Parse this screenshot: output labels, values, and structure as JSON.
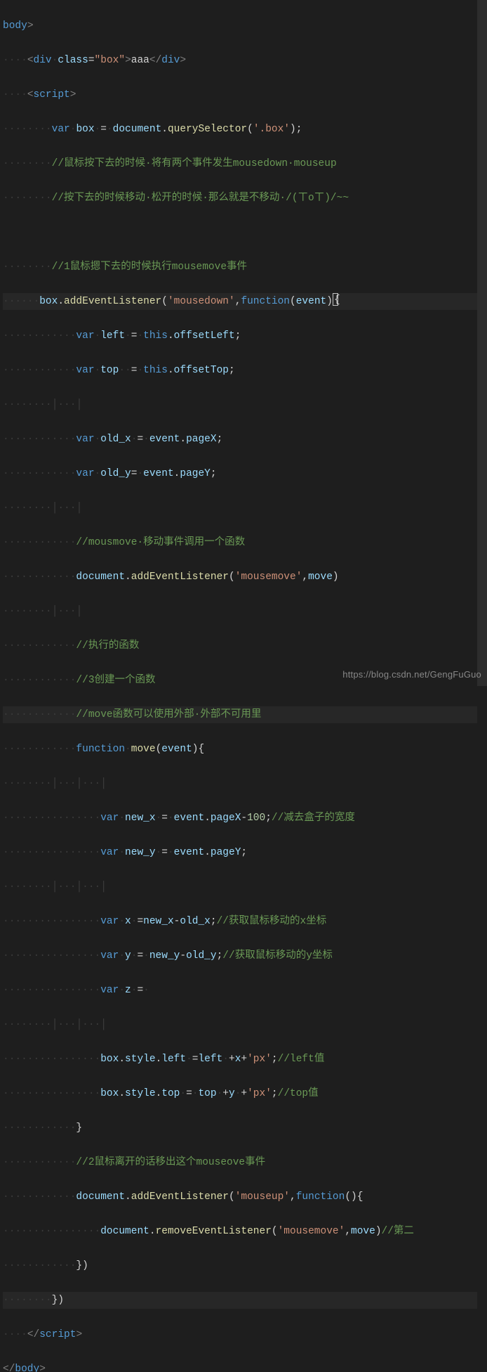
{
  "watermark": "https://blog.csdn.net/GengFuGuo",
  "code": {
    "l1": {
      "tag1": "body",
      "brkt1": ">"
    },
    "l2": {
      "ws": "····",
      "b1": "<",
      "t": "div",
      "sp": "·",
      "a": "class",
      "eq": "=",
      "s": "\"box\"",
      "b2": ">",
      "txt": "aaa",
      "b3": "</",
      "t2": "div",
      "b4": ">"
    },
    "l3": {
      "ws": "····",
      "b1": "<",
      "t": "script",
      "b2": ">"
    },
    "l4": {
      "ws": "········",
      "k1": "var",
      "sp1": "·",
      "v": "box",
      "sp2": "·",
      "eq": "=",
      "sp3": "·",
      "o": "document",
      "d": ".",
      "f": "querySelector",
      "p1": "(",
      "s": "'.box'",
      "p2": ")",
      ";": ";"
    },
    "l5": {
      "ws": "········",
      "c": "//鼠标按下去的时候·将有两个事件发生mousedown·mouseup"
    },
    "l6": {
      "ws": "········",
      "c": "//按下去的时候移动·松开的时候·那么就是不移动·/(ㄒoㄒ)/~~"
    },
    "l7": "",
    "l8": {
      "ws": "········",
      "c": "//1鼠标摁下去的时候执行mousemove事件"
    },
    "l9": {
      "ws": "······",
      "o1": "box",
      "d1": ".",
      "f": "addEventListener",
      "p1": "(",
      "s": "'mousedown'",
      "c1": ",",
      "k": "function",
      "p2": "(",
      "v": "event",
      "p3": ")",
      "cur": "{"
    },
    "l10": {
      "ws": "············",
      "k": "var",
      "sp": "·",
      "v": "left",
      "sp2": "·",
      "eq": "=",
      "sp3": "·",
      "th": "this",
      "d": ".",
      "pr": "offsetLeft",
      "sc": ";"
    },
    "l11": {
      "ws": "············",
      "k": "var",
      "sp": "·",
      "v": "top",
      "sp2": "··",
      "eq": "=",
      "sp3": "·",
      "th": "this",
      "d": ".",
      "pr": "offsetTop",
      "sc": ";"
    },
    "l12": "",
    "l13": {
      "ws": "············",
      "k": "var",
      "sp": "·",
      "v": "old_x",
      "sp2": "·",
      "eq": "=",
      "sp3": "·",
      "o": "event",
      "d": ".",
      "pr": "pageX",
      "sc": ";"
    },
    "l14": {
      "ws": "············",
      "k": "var",
      "sp": "·",
      "v": "old_y",
      "eq": "=",
      "sp3": "·",
      "o": "event",
      "d": ".",
      "pr": "pageY",
      "sc": ";"
    },
    "l15": "",
    "l16": {
      "ws": "············",
      "c": "//mousmove·移动事件调用一个函数"
    },
    "l17": {
      "ws": "············",
      "o": "document",
      "d": ".",
      "f": "addEventListener",
      "p1": "(",
      "s": "'mousemove'",
      "c1": ",",
      "v": "move",
      "p2": ")"
    },
    "l18": "",
    "l19": {
      "ws": "············",
      "c": "//执行的函数"
    },
    "l20": {
      "ws": "············",
      "c": "//3创建一个函数"
    },
    "l21": {
      "ws": "············",
      "c": "//move函数可以使用外部·外部不可用里"
    },
    "l22": {
      "ws": "············",
      "k": "function",
      "sp": "·",
      "f": "move",
      "p1": "(",
      "v": "event",
      "p2": ")",
      "br": "{"
    },
    "l23": "",
    "l24": {
      "ws": "················",
      "k": "var",
      "sp": "·",
      "v": "new_x",
      "sp2": "·",
      "eq": "=",
      "sp3": "·",
      "o": "event",
      "d": ".",
      "pr": "pageX",
      "op": "-",
      "n": "100",
      "sc": ";",
      "c": "//减去盒子的宽度"
    },
    "l25": {
      "ws": "················",
      "k": "var",
      "sp": "·",
      "v": "new_y",
      "sp2": "·",
      "eq": "=",
      "sp3": "·",
      "o": "event",
      "d": ".",
      "pr": "pageY",
      "sc": ";"
    },
    "l26": "",
    "l27": {
      "ws": "················",
      "k": "var",
      "sp": "·",
      "v": "x",
      "sp2": "·",
      "eq": "=",
      "v2": "new_x",
      "op": "-",
      "v3": "old_x",
      "sc": ";",
      "c": "//获取鼠标移动的x坐标"
    },
    "l28": {
      "ws": "················",
      "k": "var",
      "sp": "·",
      "v": "y",
      "sp2": "·",
      "eq": "=",
      "sp3": "·",
      "v2": "new_y",
      "op": "-",
      "v3": "old_y",
      "sc": ";",
      "c": "//获取鼠标移动的y坐标"
    },
    "l29": {
      "ws": "················",
      "k": "var",
      "sp": "·",
      "v": "z",
      "sp2": "·",
      "eq": "=",
      "sp3": "·"
    },
    "l30": "",
    "l31": {
      "ws": "················",
      "o": "box",
      "d": ".",
      "pr": "style",
      "d2": ".",
      "pr2": "left",
      "sp": "·",
      "eq": "=",
      "v": "left",
      "sp2": "·",
      "op": "+",
      "v2": "x",
      "op2": "+",
      "s": "'px'",
      "sc": ";",
      "c": "//left值"
    },
    "l32": {
      "ws": "················",
      "o": "box",
      "d": ".",
      "pr": "style",
      "d2": ".",
      "pr2": "top",
      "sp": "·",
      "eq": "=",
      "sp2": "·",
      "v": "top",
      "sp3": "·",
      "op": "+",
      "v2": "y",
      "sp4": "·",
      "op2": "+",
      "s": "'px'",
      "sc": ";",
      "c": "//top值"
    },
    "l33": {
      "ws": "············",
      "br": "}"
    },
    "l34": {
      "ws": "············",
      "c": "//2鼠标离开的话移出这个mouseove事件"
    },
    "l35": {
      "ws": "············",
      "o": "document",
      "d": ".",
      "f": "addEventListener",
      "p1": "(",
      "s": "'mouseup'",
      "c1": ",",
      "k": "function",
      "p2": "()",
      "br": "{"
    },
    "l36": {
      "ws": "················",
      "o": "document",
      "d": ".",
      "f": "removeEventListener",
      "p1": "(",
      "s": "'mousemove'",
      "c1": ",",
      "v": "move",
      "p2": ")",
      "c2": "//第二"
    },
    "l37": {
      "ws": "············",
      "br": "})"
    },
    "l38": {
      "ws": "········",
      "br": "})"
    },
    "l39": {
      "ws": "····",
      "b1": "</",
      "t": "script",
      "b2": ">"
    },
    "l40": {
      "b1": "</",
      "t": "body",
      "b2": ">"
    }
  }
}
